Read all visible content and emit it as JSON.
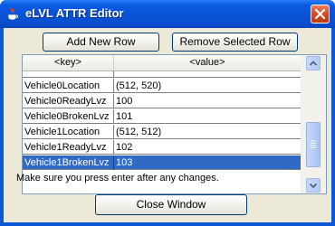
{
  "window": {
    "title": "eLVL ATTR Editor"
  },
  "toolbar": {
    "add_label": "Add New Row",
    "remove_label": "Remove Selected Row"
  },
  "table": {
    "columns": [
      "<key>",
      "<value>"
    ],
    "partial_row": [
      "",
      ""
    ],
    "rows": [
      {
        "key": "Vehicle0Location",
        "value": "(512, 520)",
        "selected": false
      },
      {
        "key": "Vehicle0ReadyLvz",
        "value": "100",
        "selected": false
      },
      {
        "key": "Vehicle0BrokenLvz",
        "value": "101",
        "selected": false
      },
      {
        "key": "Vehicle1Location",
        "value": "(512, 512)",
        "selected": false
      },
      {
        "key": "Vehicle1ReadyLvz",
        "value": "102",
        "selected": false
      },
      {
        "key": "Vehicle1BrokenLvz",
        "value": "103",
        "selected": true
      }
    ]
  },
  "info": {
    "text": "Make sure you press enter after any changes."
  },
  "footer": {
    "close_label": "Close Window"
  },
  "colors": {
    "titlebar": "#0a5be4",
    "selection": "#316ac5",
    "client": "#ece9d8",
    "close_button": "#d4461e"
  },
  "icons": [
    "java-cup-icon",
    "close-x-icon",
    "scroll-up-icon",
    "scroll-down-icon"
  ]
}
